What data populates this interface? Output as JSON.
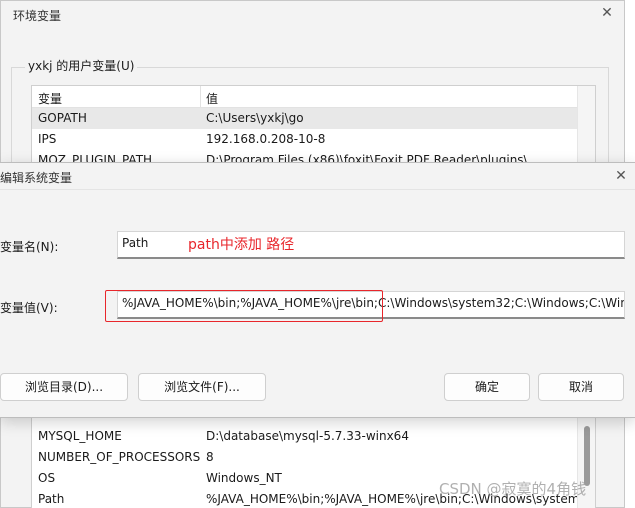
{
  "env_dialog": {
    "title": "环境变量",
    "user_section_label": "yxkj 的用户变量(U)",
    "columns": {
      "name": "变量",
      "value": "值"
    },
    "user_vars": [
      {
        "name": "GOPATH",
        "value": "C:\\Users\\yxkj\\go",
        "selected": true
      },
      {
        "name": "IPS",
        "value": "192.168.0.208-10-8",
        "selected": false
      },
      {
        "name": "MOZ_PLUGIN_PATH",
        "value": "D:\\Program Files (x86)\\foxit\\Foxit PDF Reader\\plugins\\",
        "selected": false
      }
    ],
    "system_vars": [
      {
        "name": "MYSQL_HOME",
        "value": "D:\\database\\mysql-5.7.33-winx64"
      },
      {
        "name": "NUMBER_OF_PROCESSORS",
        "value": "8"
      },
      {
        "name": "OS",
        "value": "Windows_NT"
      },
      {
        "name": "Path",
        "value": "%JAVA_HOME%\\bin;%JAVA_HOME%\\jre\\bin;C:\\Windows\\system32;C:\\Windows;C:\\Win..."
      }
    ]
  },
  "edit_dialog": {
    "title": "编辑系统变量",
    "var_name_label": "变量名(N):",
    "var_name_value": "Path",
    "var_value_label": "变量值(V):",
    "var_value": "%JAVA_HOME%\\bin;%JAVA_HOME%\\jre\\bin;C:\\Windows\\system32;C:\\Windows;C:\\Win",
    "annotation": "path中添加 路径",
    "buttons": {
      "browse_dir": "浏览目录(D)...",
      "browse_file": "浏览文件(F)...",
      "ok": "确定",
      "cancel": "取消"
    }
  },
  "watermark": "CSDN @寂寞的4角钱",
  "colors": {
    "annotation": "#e8262b",
    "dialog_bg": "#f3f3f3"
  }
}
